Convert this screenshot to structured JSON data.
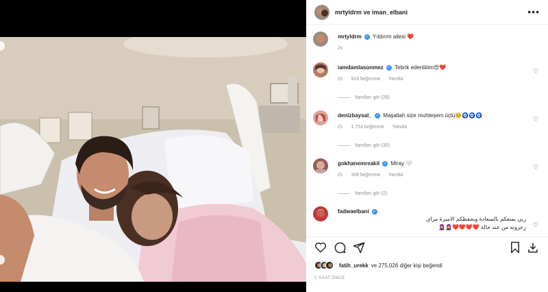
{
  "post": {
    "header_names": "mrtyldrm ve iman_elbani",
    "more_icon": "more-horizontal-icon",
    "time_ago": "2 SAAT ÖNCE"
  },
  "caption": {
    "username": "mrtyldrm",
    "text": "Yıldırım ailesi ❤️",
    "time": "2s"
  },
  "comments": [
    {
      "username": "iamdamlasonmez",
      "text": "Tebrik ederiiiiiim😍❤️",
      "time": "2s",
      "likes": "919 beğenme",
      "reply": "Yanıtla",
      "view_replies": "Yanıtları gör (26)"
    },
    {
      "username": "denizbaysal_",
      "text": "Maşallah size muhteşem üçlü🥺🧿🧿🧿",
      "time": "2s",
      "likes": "1.753 beğenme",
      "reply": "Yanıtla",
      "view_replies": "Yanıtları gör (30)"
    },
    {
      "username": "gokhanemreakil",
      "text": "Miray 🤍",
      "time": "2s",
      "likes": "308 beğenme",
      "reply": "Yanıtla",
      "view_replies": "Yanıtları gör (2)"
    },
    {
      "username": "fadwaelbani",
      "text_line1": "ربي يمتعكم بالسعادة ويحفظكم الاميرة مراي",
      "text_line2": "زعرونه من عند خالة ❤️❤️❤️❤️🧕🧕"
    }
  ],
  "likes_line": {
    "first": "fatih_urekk",
    "rest": "ve 275,026 diğer kişi beğendi"
  },
  "icons": {
    "like": "heart-icon",
    "comment": "comment-icon",
    "share": "share-icon",
    "save": "bookmark-icon",
    "download": "download-icon"
  }
}
